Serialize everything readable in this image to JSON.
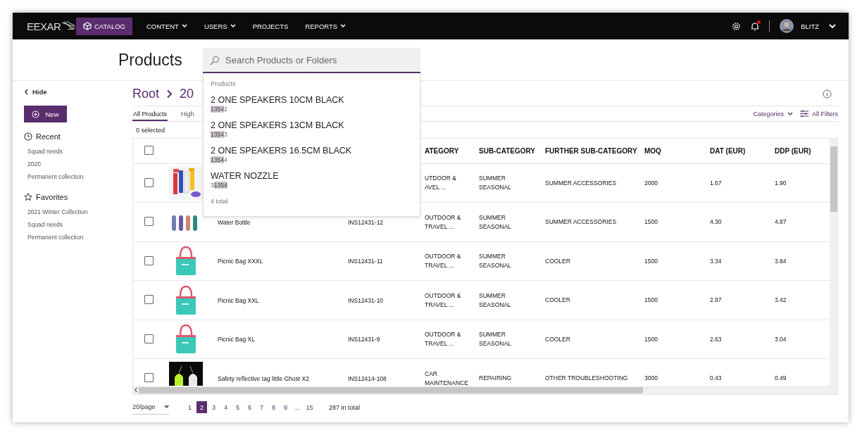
{
  "nav": {
    "logo": "EEXAR",
    "items": [
      {
        "label": "CATALOG",
        "selected": true,
        "dropdown": false
      },
      {
        "label": "CONTENT",
        "selected": false,
        "dropdown": true
      },
      {
        "label": "USERS",
        "selected": false,
        "dropdown": true
      },
      {
        "label": "PROJECTS",
        "selected": false,
        "dropdown": false
      },
      {
        "label": "REPORTS",
        "selected": false,
        "dropdown": true
      }
    ],
    "notifications_unread": true,
    "user": "BLITZ"
  },
  "page_title": "Products",
  "search": {
    "placeholder": "Search Products or Folders",
    "results_heading": "Products",
    "results": [
      {
        "name": "2 ONE SPEAKERS 10CM BLACK",
        "code_match": "1354",
        "code_post": "2"
      },
      {
        "name": "2 ONE SPEAKERS 13CM BLACK",
        "code_match": "1354",
        "code_post": "3"
      },
      {
        "name": "2 ONE SPEAKERS 16.5CM BLACK",
        "code_match": "1354",
        "code_post": "4"
      },
      {
        "name": "WATER NOZZLE",
        "code_pre": "3",
        "code_match": "1354"
      }
    ],
    "total": "4 total"
  },
  "sidebar": {
    "hide": "Hide",
    "new_button": "New",
    "recent_title": "Recent",
    "recent": [
      "Squad needs",
      "2020",
      "Permanent collection"
    ],
    "favorites_title": "Favorites",
    "favorites": [
      "2021 Winter Collection",
      "Squad needs",
      "Permanent collection"
    ]
  },
  "breadcrumb": [
    "Root",
    "20"
  ],
  "tabs": [
    {
      "label": "All Products",
      "selected": true
    },
    {
      "label": "High",
      "selected": false
    }
  ],
  "filters": {
    "categories": "Categories",
    "all_filters": "All Filters"
  },
  "selection": "0 selected",
  "table": {
    "header_checked": false,
    "columns": [
      "ATEGORY",
      "SUB-CATEGORY",
      "FURTHER SUB-CATEGORY",
      "MOQ",
      "DAT (EUR)",
      "DDP (EUR)"
    ],
    "rows": [
      {
        "checked": false,
        "category": "UTDOOR &\nAVEL ...",
        "sub": "SUMMER\nSEASONAL",
        "further": "SUMMER ACCESSORIES",
        "moq": "2000",
        "dat": "1.67",
        "ddp": "1.90"
      },
      {
        "checked": false,
        "name": "Water Bottle",
        "code": "INS12431-12",
        "category": "OUTDOOR &\nTRAVEL ...",
        "sub": "SUMMER\nSEASONAL",
        "further": "SUMMER ACCESSORIES",
        "moq": "1500",
        "dat": "4.30",
        "ddp": "4.87"
      },
      {
        "checked": false,
        "name": "Picnic Bag XXXL",
        "code": "INS12431-11",
        "category": "OUTDOOR &\nTRAVEL ...",
        "sub": "SUMMER\nSEASONAL",
        "further": "COOLER",
        "moq": "1500",
        "dat": "3.34",
        "ddp": "3.84"
      },
      {
        "checked": false,
        "name": "Picnic Bag XXL",
        "code": "INS12431-10",
        "category": "OUTDOOR &\nTRAVEL ...",
        "sub": "SUMMER\nSEASONAL",
        "further": "COOLER",
        "moq": "1500",
        "dat": "2.97",
        "ddp": "3.42"
      },
      {
        "checked": false,
        "name": "Picnic Bag XL",
        "code": "INS12431-9",
        "category": "OUTDOOR &\nTRAVEL ...",
        "sub": "SUMMER\nSEASONAL",
        "further": "COOLER",
        "moq": "1500",
        "dat": "2.63",
        "ddp": "3.04"
      },
      {
        "checked": false,
        "name": "Safety reflective tag little Ghost X2",
        "code": "INS12414-108",
        "category": "CAR\nMAINTENANCE",
        "sub": "REPAIRING",
        "further": "OTHER TROUBLESHOOTING",
        "moq": "3000",
        "dat": "0.43",
        "ddp": "0.49"
      }
    ]
  },
  "pagination": {
    "page_size": "20/page",
    "pages": [
      {
        "label": "1",
        "selected": false
      },
      {
        "label": "2",
        "selected": true
      },
      {
        "label": "3",
        "selected": false
      },
      {
        "label": "4",
        "selected": false
      },
      {
        "label": "5",
        "selected": false
      },
      {
        "label": "6",
        "selected": false
      },
      {
        "label": "7",
        "selected": false
      },
      {
        "label": "8",
        "selected": false
      },
      {
        "label": "9",
        "selected": false
      },
      {
        "label": "...",
        "selected": false
      },
      {
        "label": "15",
        "selected": false
      }
    ],
    "total": "287 in total"
  }
}
